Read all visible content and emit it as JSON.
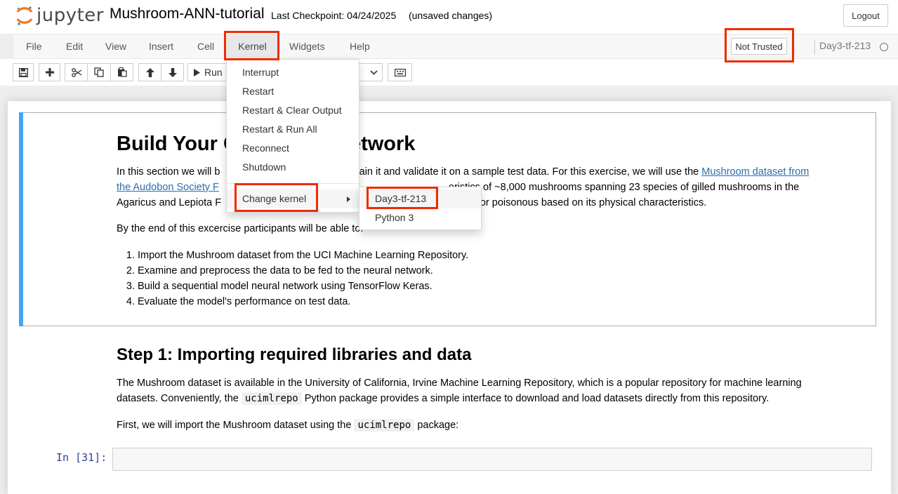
{
  "header": {
    "logo_text": "jupyter",
    "notebook_name": "Mushroom-ANN-tutorial",
    "checkpoint": "Last Checkpoint: 04/24/2025",
    "unsaved": "(unsaved changes)",
    "logout_label": "Logout"
  },
  "menubar": {
    "items": [
      "File",
      "Edit",
      "View",
      "Insert",
      "Cell",
      "Kernel",
      "Widgets",
      "Help"
    ],
    "active": "Kernel",
    "trust_label": "Not Trusted",
    "kernel_name": "Day3-tf-213"
  },
  "toolbar": {
    "run_label": "Run",
    "icons": [
      "save-icon",
      "plus-icon",
      "cut-icon",
      "copy-icon",
      "paste-icon",
      "arrow-up-icon",
      "arrow-down-icon",
      "play-icon",
      "chevron-down-icon",
      "keyboard-icon"
    ]
  },
  "kernel_menu": {
    "items": [
      "Interrupt",
      "Restart",
      "Restart & Clear Output",
      "Restart & Run All",
      "Reconnect",
      "Shutdown"
    ],
    "change_kernel": "Change kernel",
    "kernels": [
      "Day3-tf-213",
      "Python 3"
    ],
    "highlighted_kernel": "Day3-tf-213"
  },
  "cell1": {
    "heading_left": "Build Your C",
    "heading_right": "etwork",
    "p1_l1_left": "In this section we will b",
    "p1_l1_mid": "k, train it and validate it on a sample test data. For this exercise, we will use the ",
    "p1_link_l1": "Mushroom dataset from",
    "p1_link_l2_visible": "the Audobon Society F",
    "p1_l2_right": "eristics of ~8,000 mushrooms spanning 23 species of gilled mushrooms in the",
    "p1_l3_left": "Agaricus and Lepiota F",
    "p1_l3_right": "edible or poisonous based on its physical characteristics.",
    "p2_left": "By the end of this excercise participants will be ab",
    "p2_right": "le to:",
    "list": [
      "Import the Mushroom dataset from the UCI Machine Learning Repository.",
      "Examine and preprocess the data to be fed to the neural network.",
      "Build a sequential model neural network using TensorFlow Keras.",
      "Evaluate the model's performance on test data."
    ]
  },
  "cell2": {
    "heading": "Step 1: Importing required libraries and data",
    "p1_l1": "The Mushroom dataset is available in the University of California, Irvine Machine Learning Repository, which is a popular repository for machine learning",
    "p1_l2_a": "datasets. Conveniently, the ",
    "code1": "ucimlrepo",
    "p1_l2_b": " Python package provides a simple interface to download and load datasets directly from this repository.",
    "p2_a": "First, we will import the Mushroom dataset using the ",
    "code2": "ucimlrepo",
    "p2_b": " package:"
  },
  "code_cell": {
    "prompt": "In [31]:"
  },
  "colors": {
    "highlight": "#f02a00",
    "cell_selected_bar": "#42a5f5",
    "link": "#296eaa",
    "prompt": "#303f9f",
    "jupyter_orange": "#f37726"
  }
}
